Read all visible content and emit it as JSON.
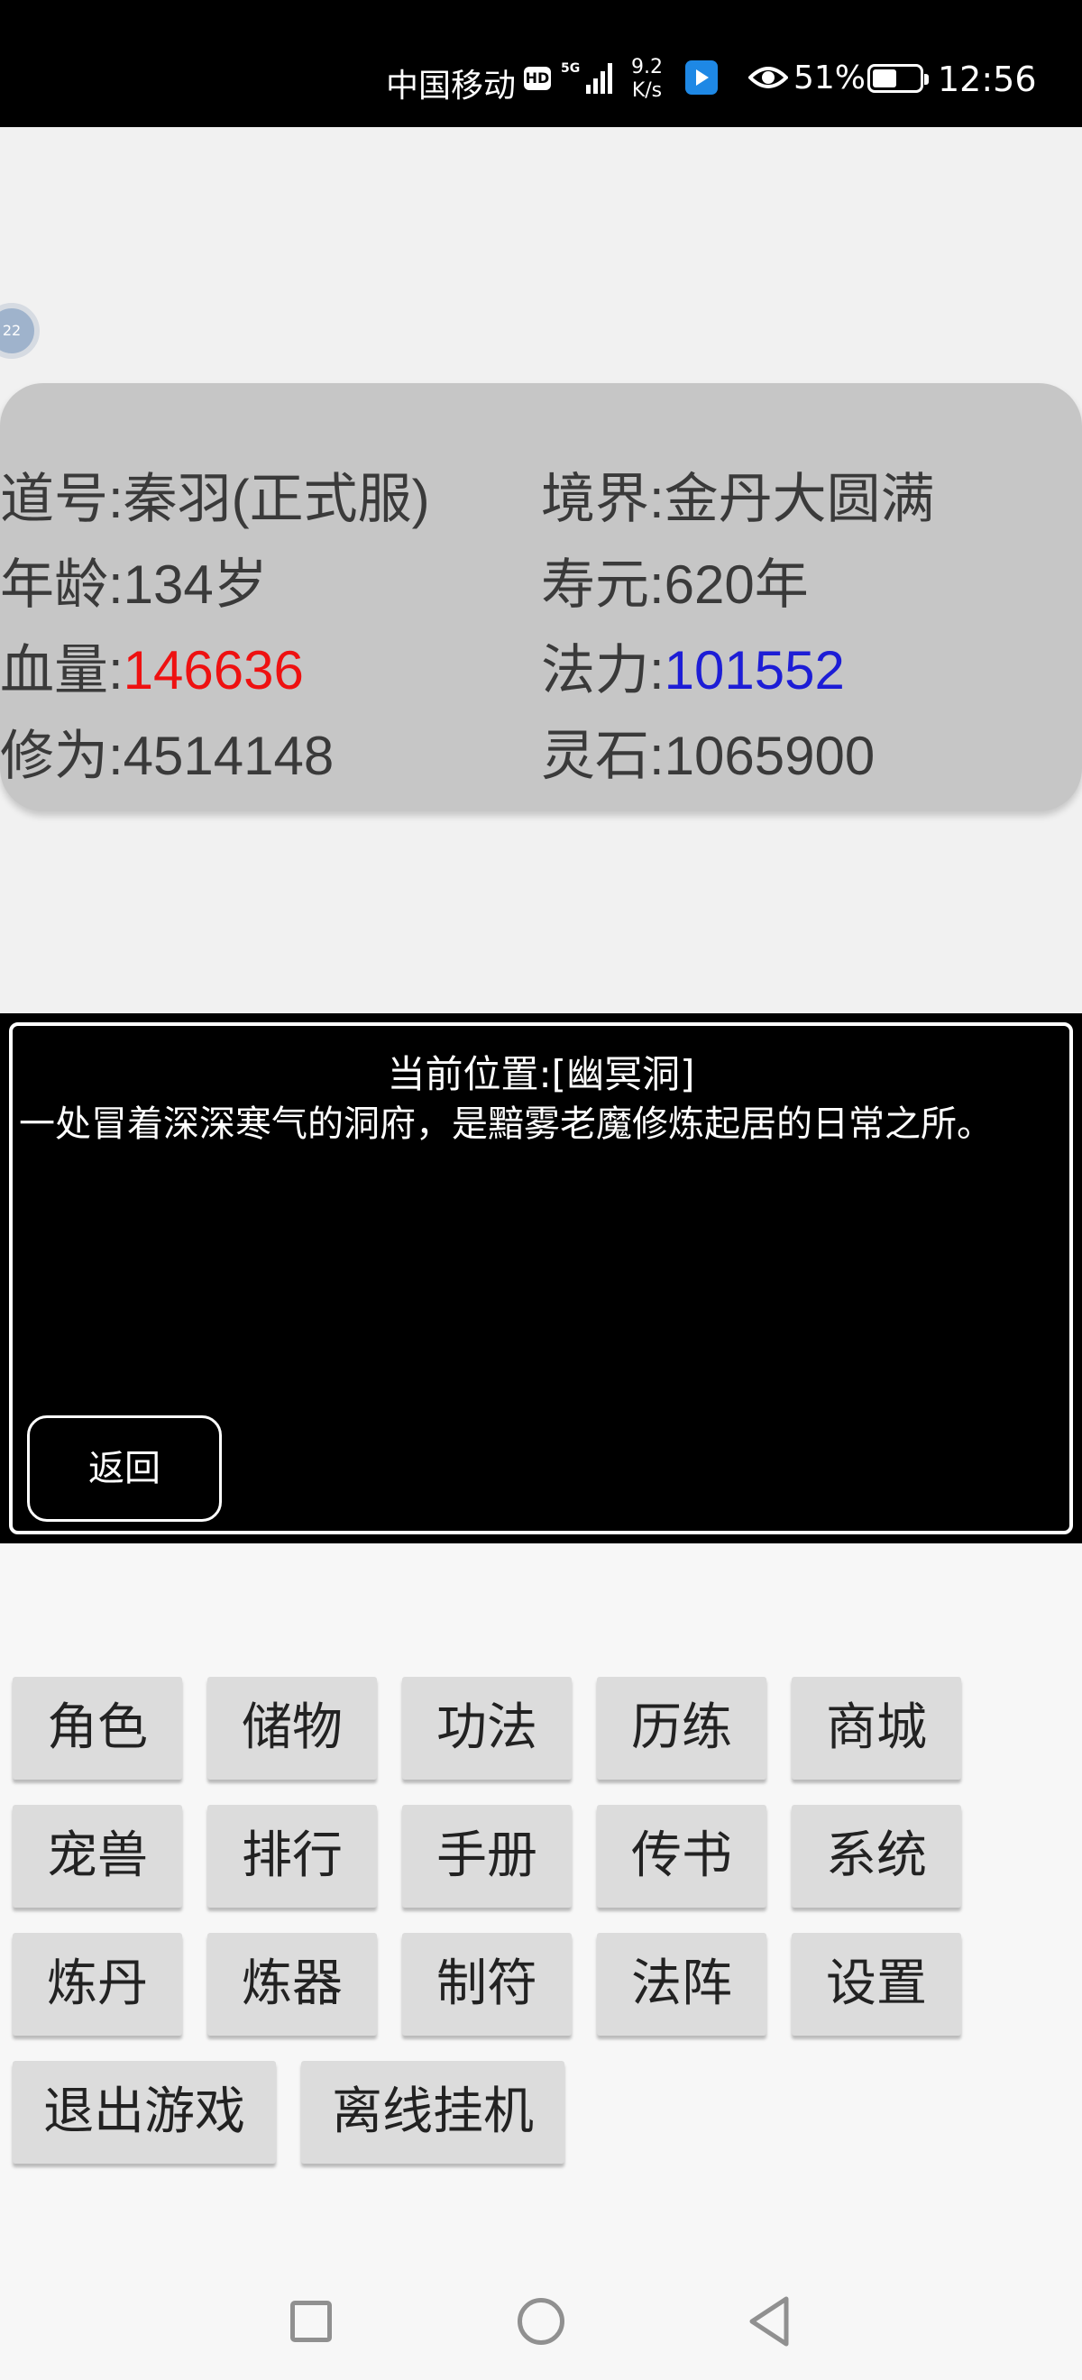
{
  "status_bar": {
    "carrier": "中国移动",
    "hd_badge": "HD",
    "network_type": "5G",
    "speed_value": "9.2",
    "speed_unit": "K/s",
    "battery_percent": "51%",
    "battery_level": 0.51,
    "time": "12:56"
  },
  "avatar": {
    "badge_text": "22"
  },
  "stats": {
    "daohao": {
      "label": "道号:",
      "value": "秦羽(正式服)"
    },
    "jingjie": {
      "label": "境界:",
      "value": "金丹大圆满"
    },
    "age": {
      "label": "年龄:",
      "value": "134岁"
    },
    "shouyuan": {
      "label": "寿元:",
      "value": "620年"
    },
    "hp": {
      "label": "血量:",
      "value": "146636",
      "color": "#ee1111"
    },
    "mana": {
      "label": "法力:",
      "value": "101552",
      "color": "#1d1dd6"
    },
    "xiuwei": {
      "label": "修为:",
      "value": "4514148"
    },
    "lingshi": {
      "label": "灵石:",
      "value": "1065900"
    }
  },
  "location": {
    "title": "当前位置:[幽冥洞]",
    "description": "一处冒着深深寒气的洞府，是黯雾老魔修炼起居的日常之所。",
    "back_label": "返回"
  },
  "menu": {
    "row1": [
      "角色",
      "储物",
      "功法",
      "历练",
      "商城"
    ],
    "row2": [
      "宠兽",
      "排行",
      "手册",
      "传书",
      "系统"
    ],
    "row3": [
      "炼丹",
      "炼器",
      "制符",
      "法阵",
      "设置"
    ],
    "row4": [
      "退出游戏",
      "离线挂机"
    ]
  },
  "colors": {
    "stats_panel": "#c6c6c6",
    "menu_button": "#dcdcdc",
    "location_bg": "#000000"
  },
  "icons": [
    "hd-icon",
    "signal-icon",
    "app-icon",
    "eye-icon",
    "battery-icon",
    "recent-apps-icon",
    "home-icon",
    "back-icon"
  ]
}
